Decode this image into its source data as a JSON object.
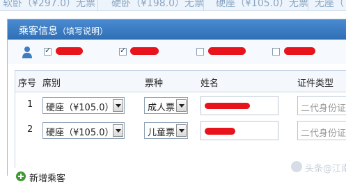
{
  "top_row": {
    "cells": [
      "软卧（¥297.0）无票",
      "硬卧（¥198.0）无票",
      "硬座（¥105.0）无票",
      "无座（"
    ]
  },
  "panel": {
    "title": "乘客信息",
    "subtitle_open": "（",
    "subtitle_link": "填写说明",
    "subtitle_close": "）"
  },
  "contacts": [
    {
      "checked": true
    },
    {
      "checked": true
    },
    {
      "checked": false
    },
    {
      "checked": false
    }
  ],
  "table": {
    "headers": {
      "seq": "序号",
      "seat": "席别",
      "ticket": "票种",
      "name": "姓名",
      "id_type": "证件类型"
    },
    "rows": [
      {
        "seq": "1",
        "seat": "硬座（¥105.0）",
        "ticket": "成人票",
        "id_placeholder": "二代身份证"
      },
      {
        "seq": "2",
        "seat": "硬座（¥105.0）",
        "ticket": "儿童票",
        "id_placeholder": "二代身份证"
      }
    ]
  },
  "add_passenger_label": "新增乘客",
  "watermark": "头条@江南",
  "colors": {
    "header_blue": "#3a7cc4",
    "redaction": "#e8131b",
    "add_green": "#3d9b2f"
  }
}
